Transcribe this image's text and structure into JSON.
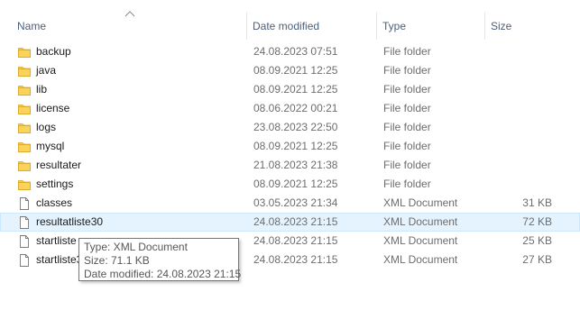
{
  "columns": {
    "name": "Name",
    "date": "Date modified",
    "type": "Type",
    "size": "Size"
  },
  "sort_indicator": "up-chevron-icon",
  "colors": {
    "folder": "#f8c94a",
    "hover_background": "#e5f3ff",
    "hover_border": "#cce8ff",
    "header_text": "#4c607a",
    "meta_text": "#6d6d6d"
  },
  "rows": [
    {
      "name": "backup",
      "date": "24.08.2023 07:51",
      "type": "File folder",
      "size": "",
      "icon": "folder-icon"
    },
    {
      "name": "java",
      "date": "08.09.2021 12:25",
      "type": "File folder",
      "size": "",
      "icon": "folder-icon"
    },
    {
      "name": "lib",
      "date": "08.09.2021 12:25",
      "type": "File folder",
      "size": "",
      "icon": "folder-icon"
    },
    {
      "name": "license",
      "date": "08.06.2022 00:21",
      "type": "File folder",
      "size": "",
      "icon": "folder-icon"
    },
    {
      "name": "logs",
      "date": "23.08.2023 22:50",
      "type": "File folder",
      "size": "",
      "icon": "folder-icon"
    },
    {
      "name": "mysql",
      "date": "08.09.2021 12:25",
      "type": "File folder",
      "size": "",
      "icon": "folder-icon"
    },
    {
      "name": "resultater",
      "date": "21.08.2023 21:38",
      "type": "File folder",
      "size": "",
      "icon": "folder-icon"
    },
    {
      "name": "settings",
      "date": "08.09.2021 12:25",
      "type": "File folder",
      "size": "",
      "icon": "folder-icon"
    },
    {
      "name": "classes",
      "date": "03.05.2023 21:34",
      "type": "XML Document",
      "size": "31 KB",
      "icon": "file-icon"
    },
    {
      "name": "resultatliste30",
      "date": "24.08.2023 21:15",
      "type": "XML Document",
      "size": "72 KB",
      "icon": "file-icon",
      "hovered": true
    },
    {
      "name": "startliste",
      "date": "24.08.2023 21:15",
      "type": "XML Document",
      "size": "25 KB",
      "icon": "file-icon"
    },
    {
      "name": "startliste3",
      "date": "24.08.2023 21:15",
      "type": "XML Document",
      "size": "27 KB",
      "icon": "file-icon"
    }
  ],
  "tooltip": {
    "type_line": "Type: XML Document",
    "size_line": "Size: 71.1 KB",
    "date_line": "Date modified: 24.08.2023 21:15"
  }
}
